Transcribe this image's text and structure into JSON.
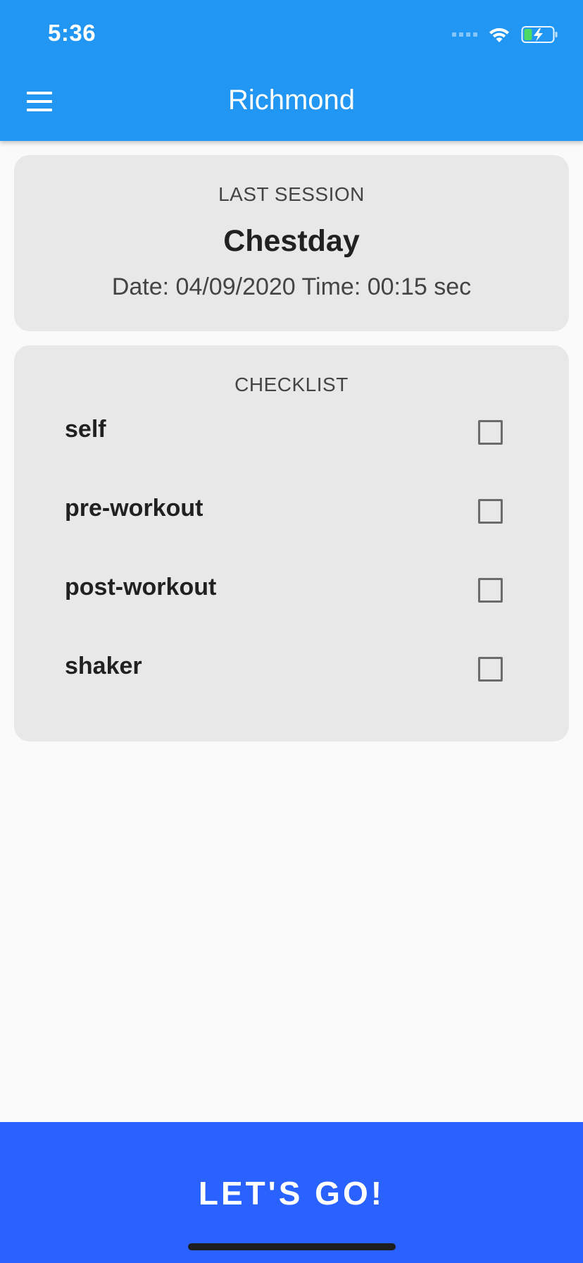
{
  "status_bar": {
    "time": "5:36",
    "icons": [
      "cellular-signal-icon",
      "wifi-icon",
      "battery-charging-icon"
    ]
  },
  "app_bar": {
    "menu_icon": "hamburger-menu-icon",
    "title": "Richmond",
    "color": "#2196f3"
  },
  "last_session": {
    "label": "LAST SESSION",
    "name": "Chestday",
    "meta": "Date: 04/09/2020 Time: 00:15 sec"
  },
  "checklist": {
    "label": "CHECKLIST",
    "items": [
      {
        "label": "self",
        "checked": false
      },
      {
        "label": "pre-workout",
        "checked": false
      },
      {
        "label": "post-workout",
        "checked": false
      },
      {
        "label": "shaker",
        "checked": false
      }
    ]
  },
  "footer": {
    "button_label": "LET'S GO!",
    "button_color": "#2962ff"
  }
}
